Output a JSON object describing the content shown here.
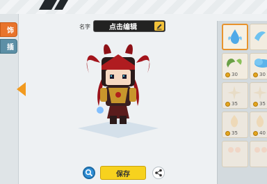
{
  "tabs": [
    {
      "label": "饰",
      "active": true
    },
    {
      "label": "插",
      "active": false
    }
  ],
  "name_label": "名字",
  "name_value": "点击编辑",
  "save_label": "保存",
  "items": [
    {
      "icon": "blue-splash-icon",
      "price": "",
      "selected": true
    },
    {
      "icon": "blue-wing-icon",
      "price": "",
      "selected": false
    },
    {
      "icon": "green-leaf-icon",
      "price": "30",
      "selected": false
    },
    {
      "icon": "blue-cloud-icon",
      "price": "30",
      "selected": false
    },
    {
      "icon": "pale-sparkle-icon",
      "price": "35",
      "selected": false
    },
    {
      "icon": "pale-sparkle-icon",
      "price": "35",
      "selected": false
    },
    {
      "icon": "pale-flame-icon",
      "price": "35",
      "selected": false
    },
    {
      "icon": "pale-flame-icon",
      "price": "40",
      "selected": false
    },
    {
      "icon": "pale-petal-icon",
      "price": "",
      "selected": false
    },
    {
      "icon": "pale-petal-icon",
      "price": "",
      "selected": false
    }
  ],
  "colors": {
    "tab_active": "#e8742c",
    "save_button": "#f7d21e",
    "arrow": "#f29a1e",
    "zoom_button": "#2f8fd6"
  }
}
